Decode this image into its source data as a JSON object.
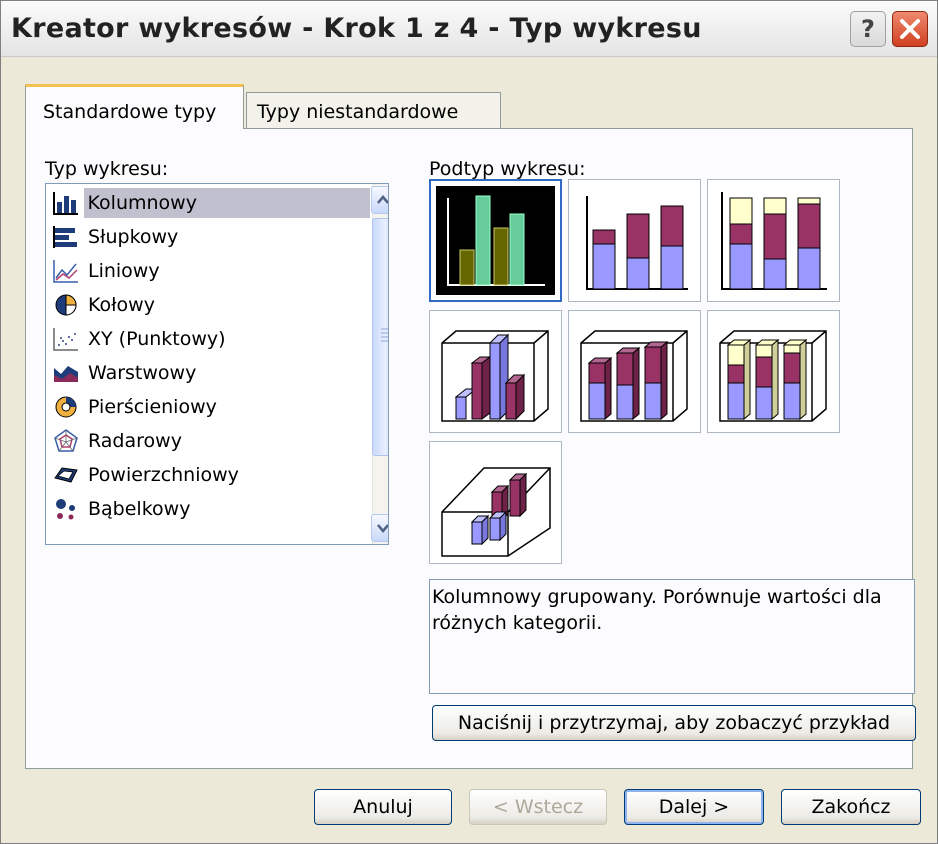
{
  "window": {
    "title": "Kreator wykresów - Krok 1 z 4 - Typ wykresu",
    "help_glyph": "?"
  },
  "tabs": [
    {
      "label": "Standardowe typy",
      "active": true
    },
    {
      "label": "Typy niestandardowe",
      "active": false
    }
  ],
  "chart_type": {
    "label": "Typ wykresu:",
    "items": [
      {
        "label": "Kolumnowy",
        "icon": "column-chart-icon",
        "selected": true
      },
      {
        "label": "Słupkowy",
        "icon": "bar-chart-icon"
      },
      {
        "label": "Liniowy",
        "icon": "line-chart-icon"
      },
      {
        "label": "Kołowy",
        "icon": "pie-chart-icon"
      },
      {
        "label": "XY (Punktowy)",
        "icon": "scatter-chart-icon"
      },
      {
        "label": "Warstwowy",
        "icon": "area-chart-icon"
      },
      {
        "label": "Pierścieniowy",
        "icon": "doughnut-chart-icon"
      },
      {
        "label": "Radarowy",
        "icon": "radar-chart-icon"
      },
      {
        "label": "Powierzchniowy",
        "icon": "surface-chart-icon"
      },
      {
        "label": "Bąbelkowy",
        "icon": "bubble-chart-icon"
      }
    ]
  },
  "subtype": {
    "label": "Podtyp wykresu:",
    "selected_index": 0,
    "count": 7,
    "description": "Kolumnowy grupowany. Porównuje wartości dla różnych kategorii.",
    "preview_button": "Naciśnij i przytrzymaj, aby zobaczyć przykład"
  },
  "buttons": {
    "cancel": "Anuluj",
    "back": "< Wstecz",
    "next": "Dalej >",
    "finish": "Zakończ"
  },
  "colors": {
    "selection": "#c1c0ce",
    "series_blue": "#9999ff",
    "series_plum": "#993366",
    "series_cream": "#ffffcc",
    "close_red": "#d04020"
  }
}
